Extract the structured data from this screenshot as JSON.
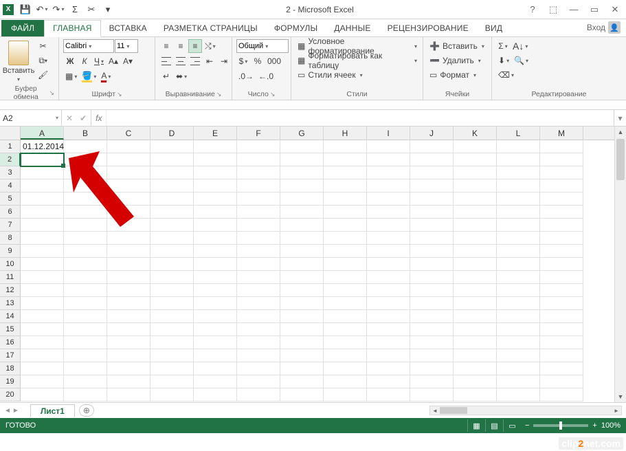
{
  "window": {
    "title": "2 - Microsoft Excel"
  },
  "qat": {
    "save": "💾",
    "undo": "↶",
    "redo": "↷",
    "sum": "Σ",
    "cut": "✂",
    "more": "▾"
  },
  "tabs": {
    "file": "ФАЙЛ",
    "items": [
      "ГЛАВНАЯ",
      "ВСТАВКА",
      "РАЗМЕТКА СТРАНИЦЫ",
      "ФОРМУЛЫ",
      "ДАННЫЕ",
      "РЕЦЕНЗИРОВАНИЕ",
      "ВИД"
    ],
    "active_index": 0,
    "login": "Вход"
  },
  "ribbon": {
    "clipboard": {
      "paste": "Вставить",
      "label": "Буфер обмена"
    },
    "font": {
      "name": "Calibri",
      "size": "11",
      "label": "Шрифт",
      "bold": "Ж",
      "italic": "К",
      "underline": "Ч"
    },
    "alignment": {
      "label": "Выравнивание"
    },
    "number": {
      "format": "Общий",
      "label": "Число"
    },
    "styles": {
      "cond_format": "Условное форматирование",
      "as_table": "Форматировать как таблицу",
      "cell_styles": "Стили ячеек",
      "label": "Стили"
    },
    "cells": {
      "insert": "Вставить",
      "delete": "Удалить",
      "format": "Формат",
      "label": "Ячейки"
    },
    "editing": {
      "label": "Редактирование"
    }
  },
  "namebox": {
    "ref": "A2"
  },
  "formula": {
    "value": ""
  },
  "grid": {
    "columns": [
      "A",
      "B",
      "C",
      "D",
      "E",
      "F",
      "G",
      "H",
      "I",
      "J",
      "K",
      "L",
      "M"
    ],
    "rows": 20,
    "active_cell": "A2",
    "data": {
      "A1": "01.12.2014"
    }
  },
  "sheets": {
    "active": "Лист1"
  },
  "status": {
    "ready": "ГОТОВО",
    "zoom": "100%"
  },
  "watermark": {
    "pre": "clip",
    "mid": "2",
    "post": "net.com"
  }
}
